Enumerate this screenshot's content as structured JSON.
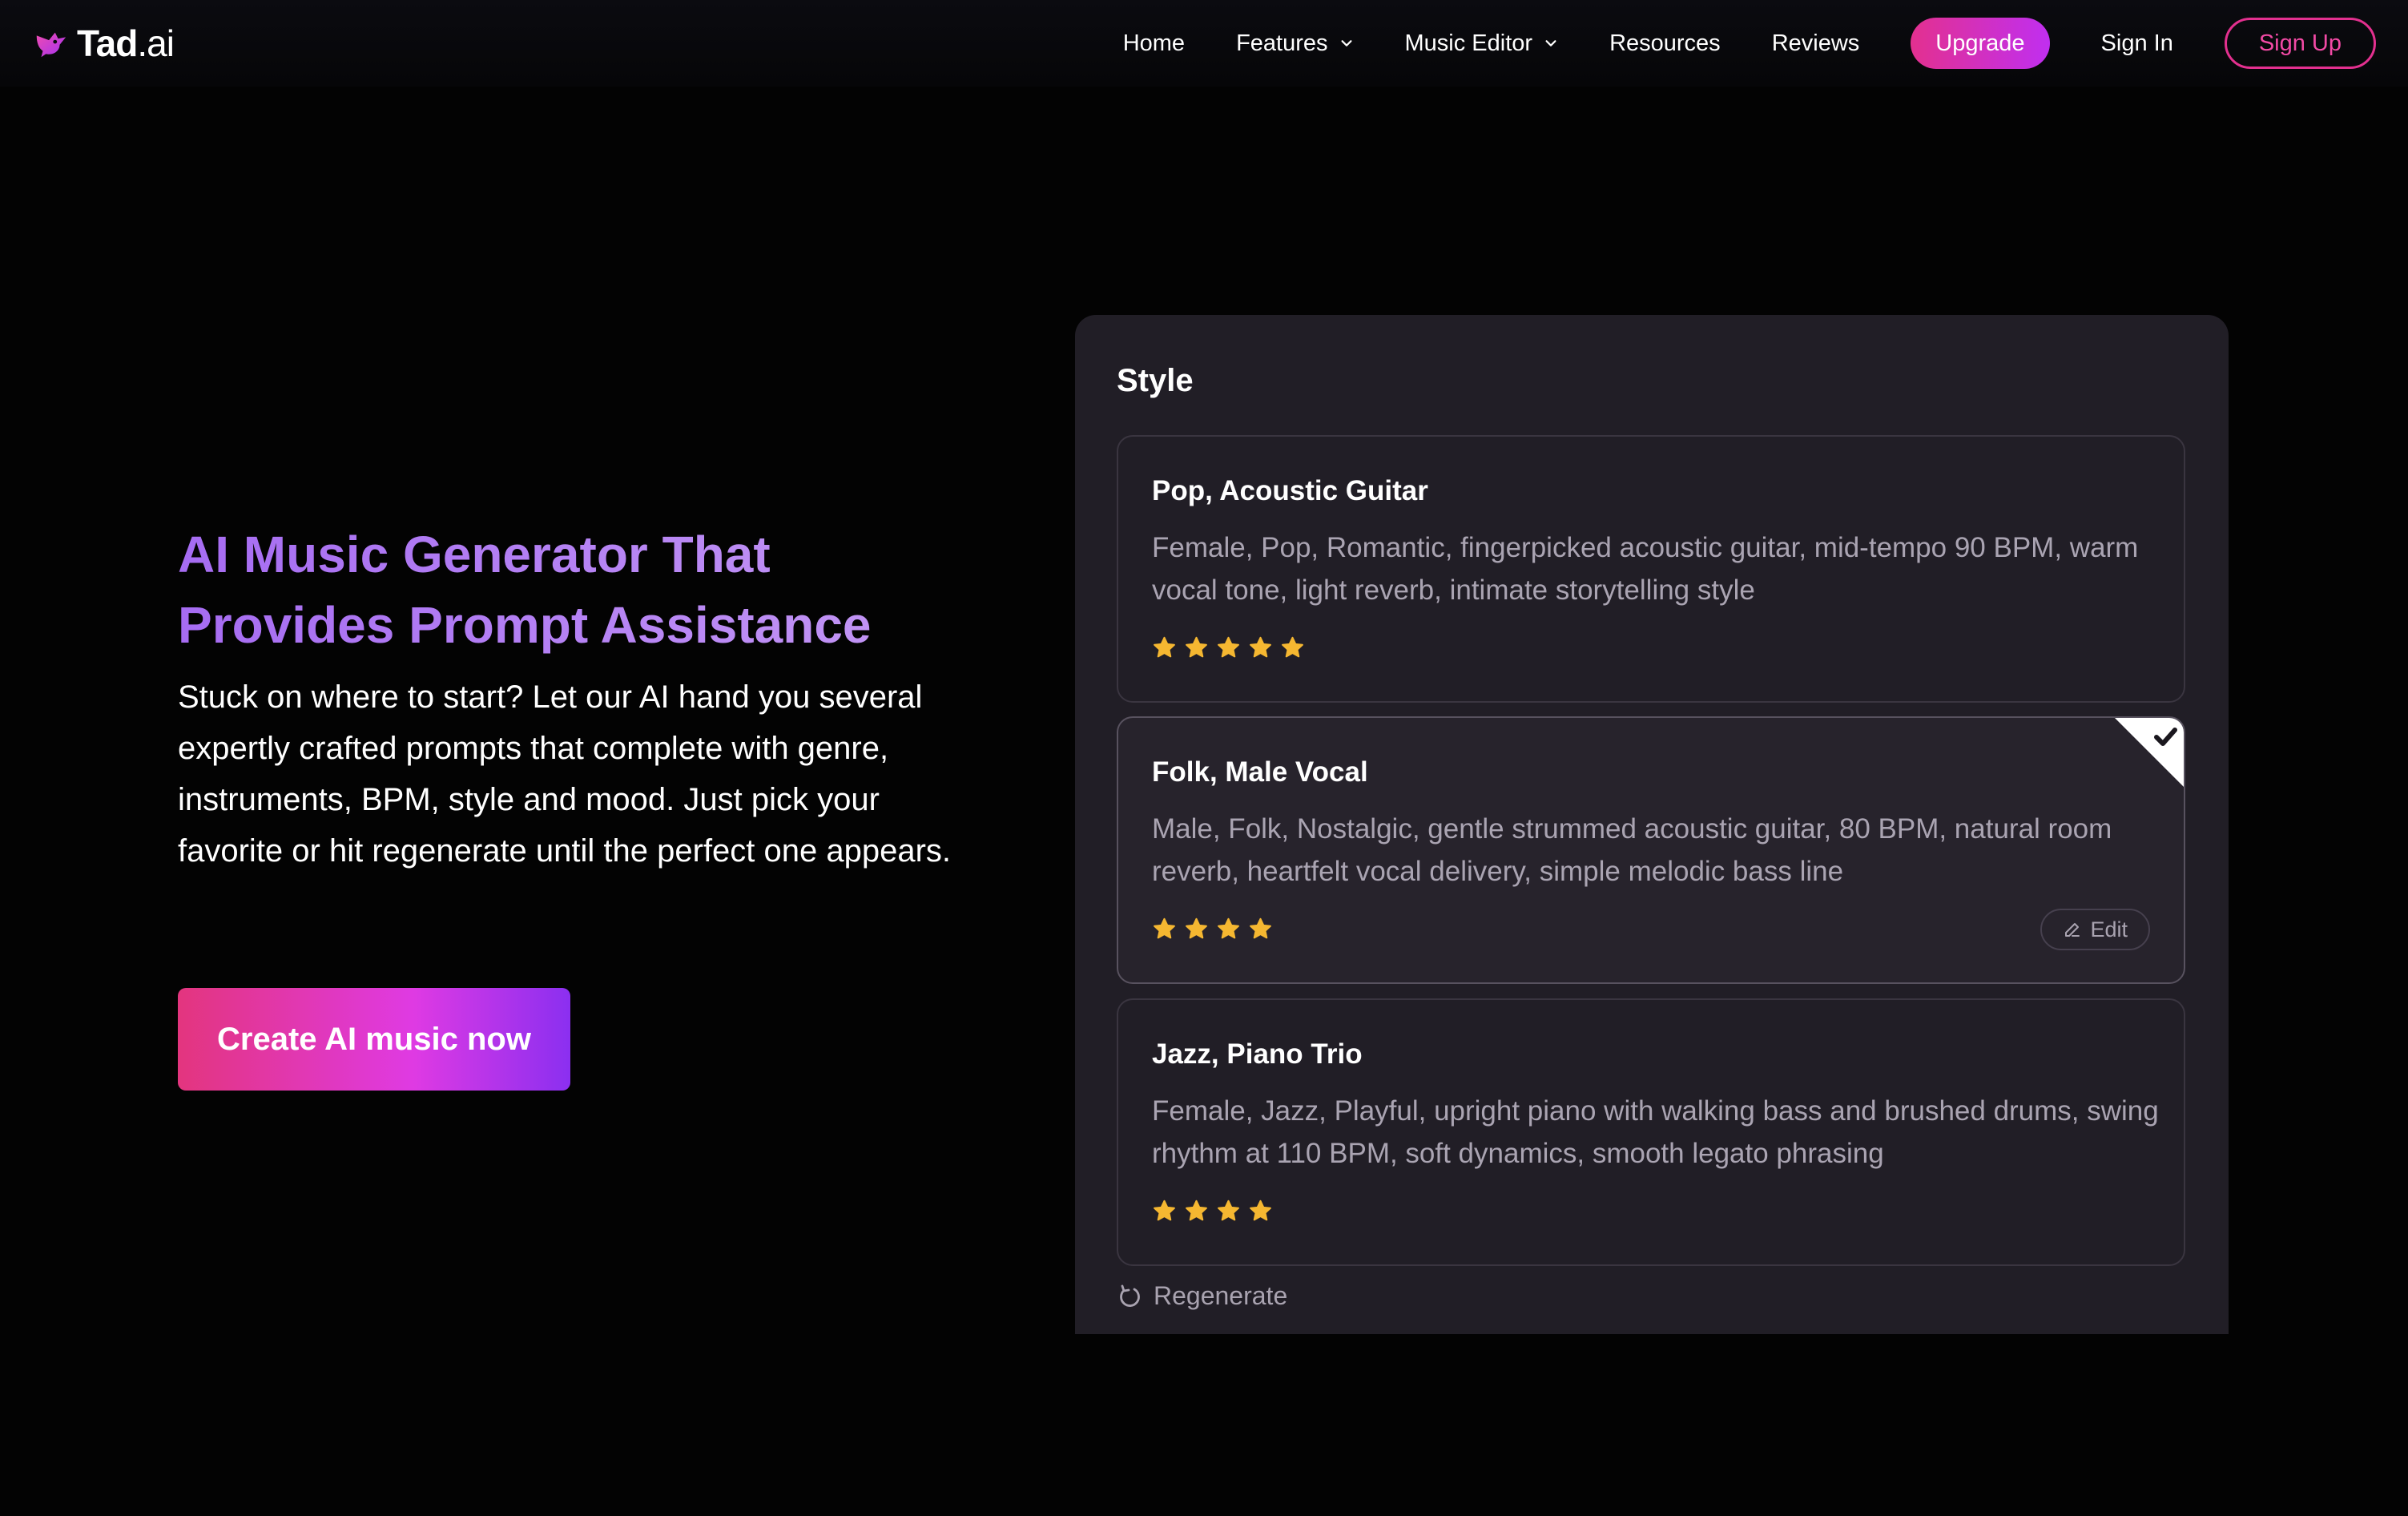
{
  "brand": {
    "name": "Tad",
    "suffix": ".ai",
    "accent": "#e3308f",
    "accent_purple": "#c02ff0",
    "logo_icon": "music-bird-icon"
  },
  "nav": {
    "home": "Home",
    "features": "Features",
    "music_editor": "Music Editor",
    "resources": "Resources",
    "reviews": "Reviews",
    "upgrade": "Upgrade",
    "sign_in": "Sign In",
    "sign_up": "Sign Up"
  },
  "hero": {
    "title_line1": "AI Music Generator That",
    "title_line2": "Provides Prompt Assistance",
    "description": "Stuck on where to start? Let our AI hand you several expertly crafted prompts that complete with genre, instruments, BPM, style and mood. Just pick your favorite or hit regenerate until the perfect one appears.",
    "cta": "Create AI music now"
  },
  "style_panel": {
    "title": "Style",
    "cards": [
      {
        "title": "Pop, Acoustic Guitar",
        "description": "Female, Pop, Romantic, fingerpicked acoustic guitar, mid-tempo 90 BPM, warm vocal tone, light reverb, intimate storytelling style",
        "rating": 5,
        "selected": false
      },
      {
        "title": "Folk, Male Vocal",
        "description": "Male, Folk, Nostalgic, gentle strummed acoustic guitar, 80 BPM, natural room reverb, heartfelt vocal delivery, simple melodic bass line",
        "rating": 4,
        "selected": true,
        "edit_label": "Edit"
      },
      {
        "title": "Jazz, Piano Trio",
        "description": "Female, Jazz, Playful, upright piano with walking bass and brushed drums, swing rhythm at 110 BPM, soft dynamics, smooth legato phrasing",
        "rating": 4,
        "selected": false
      }
    ],
    "regenerate": "Regenerate",
    "star_color": "#f5b731"
  }
}
